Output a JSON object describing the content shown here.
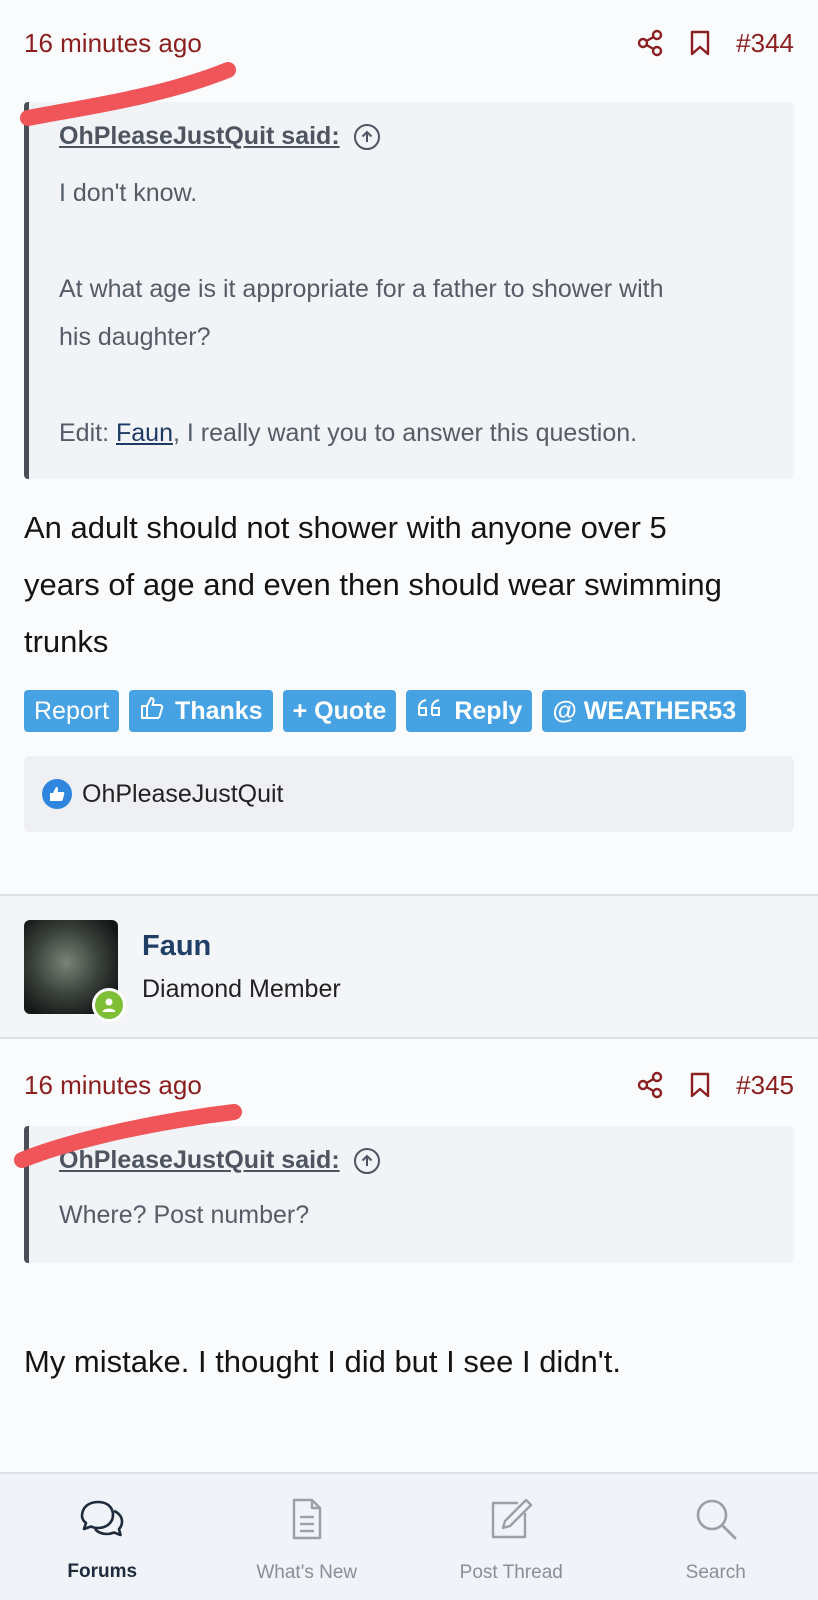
{
  "posts": [
    {
      "time": "16 minutes ago",
      "number": "#344",
      "quote": {
        "author": "OhPleaseJustQuit said:",
        "line1": "I don't know.",
        "line2a": "At what age is it appropriate for a father to shower with",
        "line2b": "his daughter?",
        "edit_prefix": "Edit: ",
        "edit_link": "Faun",
        "edit_suffix": ", I really want you to answer this question."
      },
      "body": [
        "An adult should not shower with anyone over 5",
        "years of age and even then should wear swimming",
        "trunks"
      ],
      "actions": {
        "report": "Report",
        "thanks": "Thanks",
        "quote": "+ Quote",
        "reply": "Reply",
        "mention": "@ WEATHER53"
      },
      "reaction_user": "OhPleaseJustQuit"
    },
    {
      "time": "16 minutes ago",
      "number": "#345",
      "quote": {
        "author": "OhPleaseJustQuit said:",
        "line1": "Where? Post number?"
      },
      "body": [
        "My mistake. I thought I did but I see I didn't."
      ]
    }
  ],
  "user": {
    "name": "Faun",
    "title": "Diamond Member"
  },
  "nav": [
    {
      "label": "Forums",
      "icon": "forums-icon"
    },
    {
      "label": "What's New",
      "icon": "document-icon"
    },
    {
      "label": "Post Thread",
      "icon": "pencil-icon"
    },
    {
      "label": "Search",
      "icon": "search-icon"
    }
  ],
  "colors": {
    "accent_red": "#8b1e1e",
    "button_blue": "#47a2e3",
    "scribble_red": "#f0555a"
  }
}
